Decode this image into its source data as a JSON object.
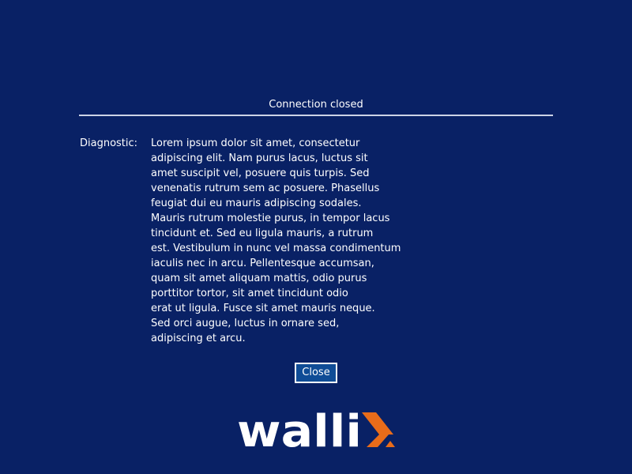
{
  "dialog": {
    "title": "Connection closed",
    "diagnostic_label": "Diagnostic:",
    "diagnostic_lines": [
      "Lorem ipsum dolor sit amet, consectetur",
      "adipiscing elit. Nam purus lacus, luctus sit",
      "amet suscipit vel, posuere quis turpis. Sed",
      "venenatis rutrum sem ac posuere. Phasellus",
      "feugiat dui eu mauris adipiscing sodales.",
      "Mauris rutrum molestie purus, in tempor lacus",
      "tincidunt et. Sed eu ligula mauris, a rutrum",
      "est. Vestibulum in nunc vel massa condimentum",
      "iaculis nec in arcu. Pellentesque accumsan,",
      "quam sit amet aliquam mattis, odio purus",
      "porttitor tortor, sit amet tincidunt odio",
      "erat ut ligula. Fusce sit amet mauris neque.",
      "Sed orci augue, luctus in ornare sed,",
      "adipiscing et arcu."
    ],
    "close_label": "Close"
  },
  "branding": {
    "logo_text": "walli",
    "logo_mark": "x",
    "logo_icon": "wallix-logo-icon"
  },
  "colors": {
    "background": "#092165",
    "text": "#ffffff",
    "separator": "#cdd3e6",
    "button_bg": "#0f4c96",
    "logo_accent": "#e86c1a"
  }
}
